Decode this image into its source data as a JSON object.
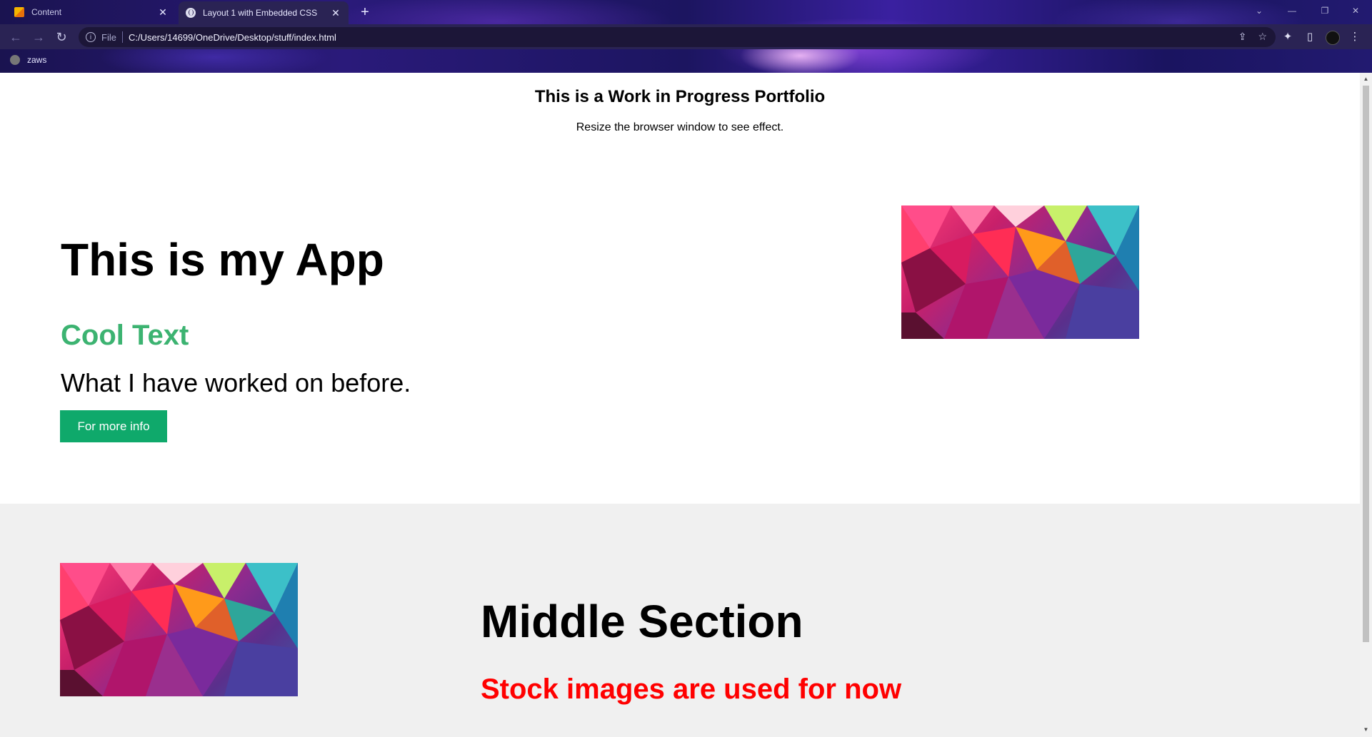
{
  "browser": {
    "tabs": [
      {
        "title": "Content",
        "active": false
      },
      {
        "title": "Layout 1 with Embedded CSS",
        "active": true
      }
    ],
    "address": {
      "scheme": "File",
      "url": "C:/Users/14699/OneDrive/Desktop/stuff/index.html"
    },
    "bookmarks": [
      {
        "label": "zaws"
      }
    ],
    "icons": {
      "back": "back-arrow-icon",
      "forward": "forward-arrow-icon",
      "reload": "reload-icon",
      "share": "share-icon",
      "star": "bookmark-star-icon",
      "extensions": "puzzle-icon",
      "sidepanel": "side-panel-icon",
      "menu": "kebab-menu-icon"
    }
  },
  "page": {
    "header": {
      "title": "This is a Work in Progress Portfolio",
      "subtitle": "Resize the browser window to see effect."
    },
    "hero": {
      "heading": "This is my App",
      "subheading": "Cool Text",
      "lead": "What I have worked on before.",
      "button_label": "For more info"
    },
    "middle": {
      "heading": "Middle Section",
      "subheading": "Stock images are used for now"
    },
    "colors": {
      "cool_text": "#3cb371",
      "button_bg": "#0fa96b",
      "stock_text": "#ff0000",
      "middle_bg": "#f0f0f0"
    }
  }
}
